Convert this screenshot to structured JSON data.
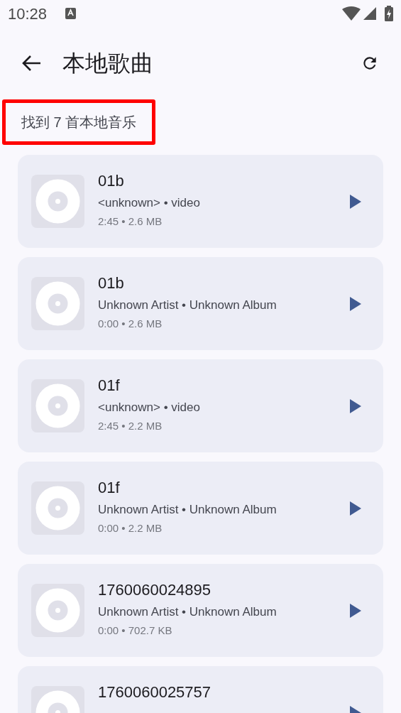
{
  "status_bar": {
    "time": "10:28"
  },
  "app_bar": {
    "title": "本地歌曲"
  },
  "count_label": {
    "text": "找到 7 首本地音乐",
    "highlighted": true
  },
  "songs": [
    {
      "title": "01b",
      "subtitle": "<unknown> • video",
      "meta": "2:45 • 2.6 MB"
    },
    {
      "title": "01b",
      "subtitle": "Unknown Artist • Unknown Album",
      "meta": "0:00 • 2.6 MB"
    },
    {
      "title": "01f",
      "subtitle": "<unknown> • video",
      "meta": "2:45 • 2.2 MB"
    },
    {
      "title": "01f",
      "subtitle": "Unknown Artist • Unknown Album",
      "meta": "0:00 • 2.2 MB"
    },
    {
      "title": "1760060024895",
      "subtitle": "Unknown Artist • Unknown Album",
      "meta": "0:00 • 702.7 KB"
    },
    {
      "title": "1760060025757"
    }
  ]
}
